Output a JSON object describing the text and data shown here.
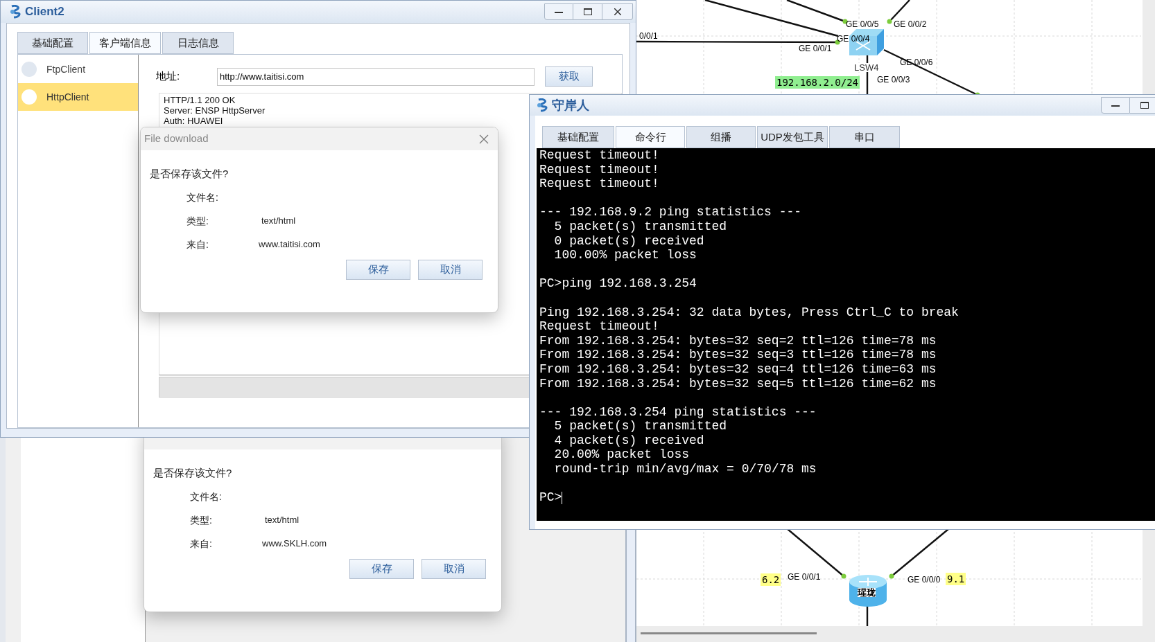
{
  "client_window": {
    "title": "Client2",
    "tabs": [
      {
        "label": "基础配置",
        "selected": false
      },
      {
        "label": "客户端信息",
        "selected": true
      },
      {
        "label": "日志信息",
        "selected": false
      }
    ],
    "clients": [
      {
        "name": "FtpClient",
        "selected": false
      },
      {
        "name": "HttpClient",
        "selected": true
      }
    ],
    "address_label": "地址:",
    "address": "http://www.taitisi.com",
    "fetch_button": "获取",
    "response_lines": [
      "HTTP/1.1 200 OK",
      "Server: ENSP HttpServer",
      "Auth: HUAWEI"
    ]
  },
  "dialogs": [
    {
      "title": "File download",
      "question": "是否保存该文件?",
      "filename_label": "文件名:",
      "type_label": "类型:",
      "type_value": "text/html",
      "from_label": "来自:",
      "from_value": "www.taitisi.com",
      "buttons": [
        "保存",
        "取消"
      ]
    },
    {
      "question": "是否保存该文件?",
      "filename_label": "文件名:",
      "type_label": "类型:",
      "type_value": "text/html",
      "from_label": "来自:",
      "from_value": "www.SKLH.com",
      "buttons": [
        "保存",
        "取消"
      ]
    }
  ],
  "terminal_window": {
    "title": "守岸人",
    "tabs": [
      {
        "label": "基础配置",
        "selected": false
      },
      {
        "label": "命令行",
        "selected": true
      },
      {
        "label": "组播",
        "selected": false
      },
      {
        "label": "UDP发包工具",
        "selected": false
      },
      {
        "label": "串口",
        "selected": false
      }
    ],
    "blocks": [
      [
        "Request timeout!",
        "Request timeout!",
        "Request timeout!"
      ],
      [
        "--- 192.168.9.2 ping statistics ---",
        "  5 packet(s) transmitted",
        "  0 packet(s) received",
        "  100.00% packet loss"
      ],
      [
        "PC>ping 192.168.3.254"
      ],
      [
        "Ping 192.168.3.254: 32 data bytes, Press Ctrl_C to break",
        "Request timeout!",
        "From 192.168.3.254: bytes=32 seq=2 ttl=126 time=78 ms",
        "From 192.168.3.254: bytes=32 seq=3 ttl=126 time=78 ms",
        "From 192.168.3.254: bytes=32 seq=4 ttl=126 time=63 ms",
        "From 192.168.3.254: bytes=32 seq=5 ttl=126 time=62 ms"
      ],
      [
        "--- 192.168.3.254 ping statistics ---",
        "  5 packet(s) transmitted",
        "  4 packet(s) received",
        "  20.00% packet loss",
        "  round-trip min/avg/max = 0/70/78 ms"
      ]
    ],
    "prompt": "PC>"
  },
  "topology": {
    "devices": [
      {
        "kind": "switch",
        "name": "LSW4"
      },
      {
        "kind": "router",
        "name": "瑆珑"
      }
    ],
    "labels": [
      {
        "kind": "port",
        "text": "GE 0/0/5"
      },
      {
        "kind": "port",
        "text": "GE 0/0/2"
      },
      {
        "kind": "port",
        "text": "GE 0/0/4"
      },
      {
        "kind": "port",
        "text": "GE 0/0/1"
      },
      {
        "kind": "port",
        "text": "GE 0/0/6"
      },
      {
        "kind": "port",
        "text": "GE 0/0/3"
      },
      {
        "kind": "port",
        "text": "0/0/1"
      },
      {
        "kind": "subnet",
        "text": "192.168.2.0/24",
        "color": "#90ee90"
      },
      {
        "kind": "subnet",
        "text": "6.2",
        "color": "#ffff88"
      },
      {
        "kind": "port",
        "text": "GE 0/0/1"
      },
      {
        "kind": "port",
        "text": "GE 0/0/0"
      },
      {
        "kind": "subnet",
        "text": "9.1",
        "color": "#ffff88"
      }
    ]
  }
}
